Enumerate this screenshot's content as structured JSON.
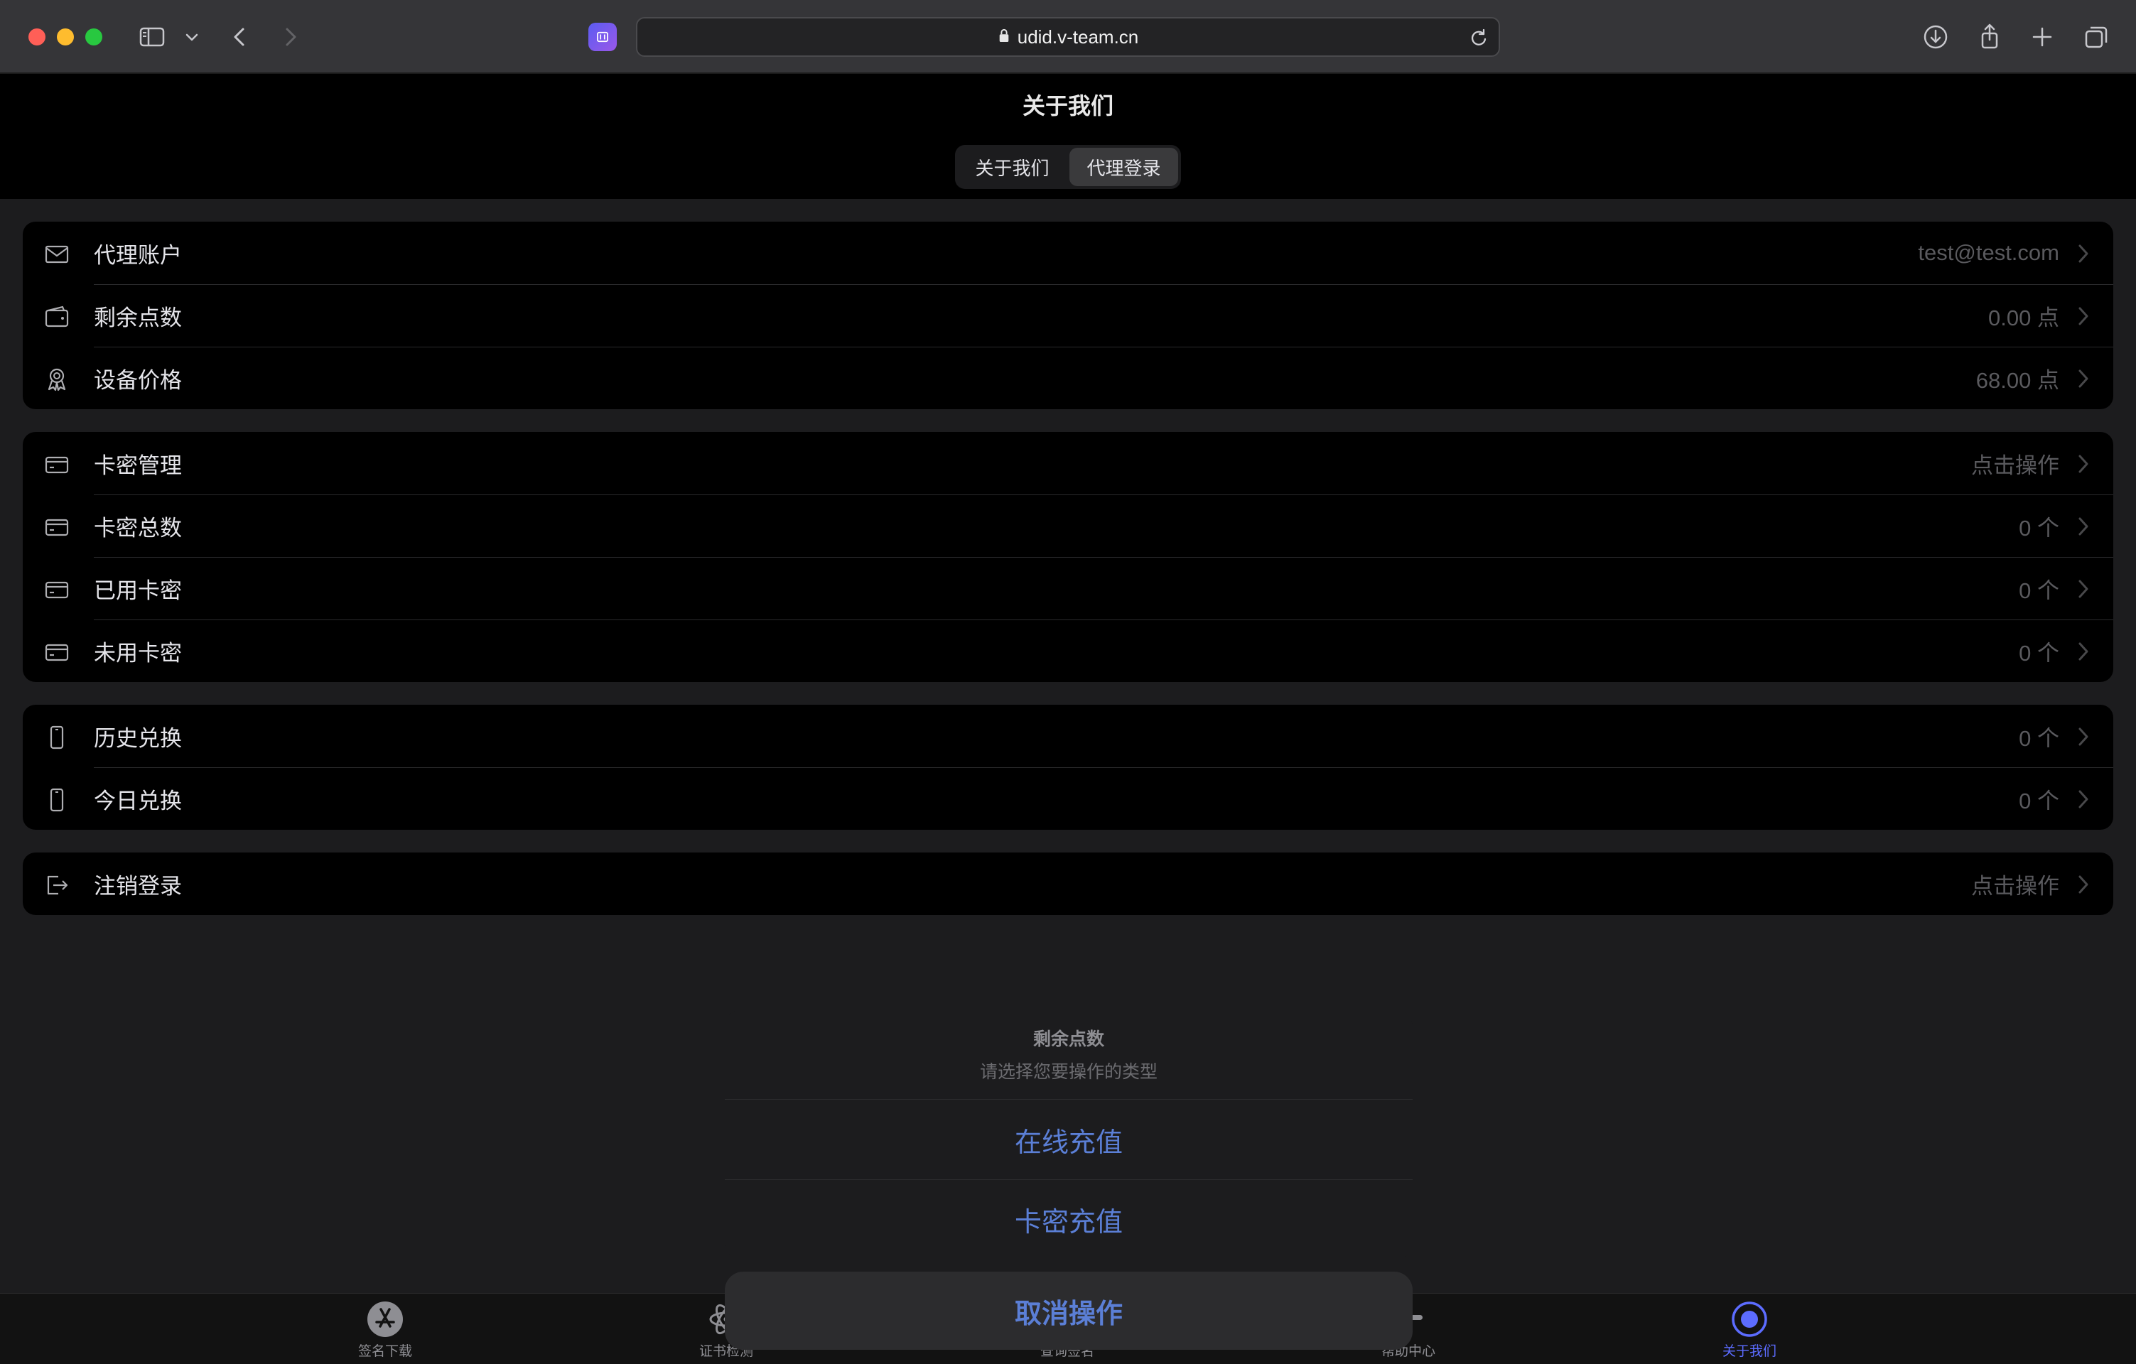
{
  "browser": {
    "url": "udid.v-team.cn"
  },
  "header": {
    "title": "关于我们",
    "segments": [
      {
        "label": "关于我们",
        "active": false
      },
      {
        "label": "代理登录",
        "active": true
      }
    ]
  },
  "groups": {
    "account": [
      {
        "icon": "mail-icon",
        "label": "代理账户",
        "value": "test@test.com"
      },
      {
        "icon": "wallet-icon",
        "label": "剩余点数",
        "value": "0.00 点"
      },
      {
        "icon": "award-icon",
        "label": "设备价格",
        "value": "68.00 点"
      }
    ],
    "cards": [
      {
        "icon": "card-icon",
        "label": "卡密管理",
        "value": "点击操作"
      },
      {
        "icon": "card-icon",
        "label": "卡密总数",
        "value": "0 个"
      },
      {
        "icon": "card-icon",
        "label": "已用卡密",
        "value": "0 个"
      },
      {
        "icon": "card-icon",
        "label": "未用卡密",
        "value": "0 个"
      }
    ],
    "exchange": [
      {
        "icon": "phone-icon",
        "label": "历史兑换",
        "value": "0 个"
      },
      {
        "icon": "phone-icon",
        "label": "今日兑换",
        "value": "0 个"
      }
    ],
    "logout": [
      {
        "icon": "logout-icon",
        "label": "注销登录",
        "value": "点击操作"
      }
    ]
  },
  "action_sheet": {
    "title": "剩余点数",
    "subtitle": "请选择您要操作的类型",
    "options": [
      "在线充值",
      "卡密充值"
    ],
    "cancel": "取消操作",
    "accent": "#5b7fd6"
  },
  "tabbar": {
    "tabs": [
      {
        "label": "签名下载",
        "icon": "app-store-icon",
        "active": false
      },
      {
        "label": "证书检测",
        "icon": "atom-icon",
        "active": false
      },
      {
        "label": "查询签名",
        "icon": "search-icon",
        "active": false
      },
      {
        "label": "帮助中心",
        "icon": "slack-icon",
        "active": false
      },
      {
        "label": "关于我们",
        "icon": "target-icon",
        "active": true
      }
    ],
    "active_color": "#5c6cff"
  }
}
